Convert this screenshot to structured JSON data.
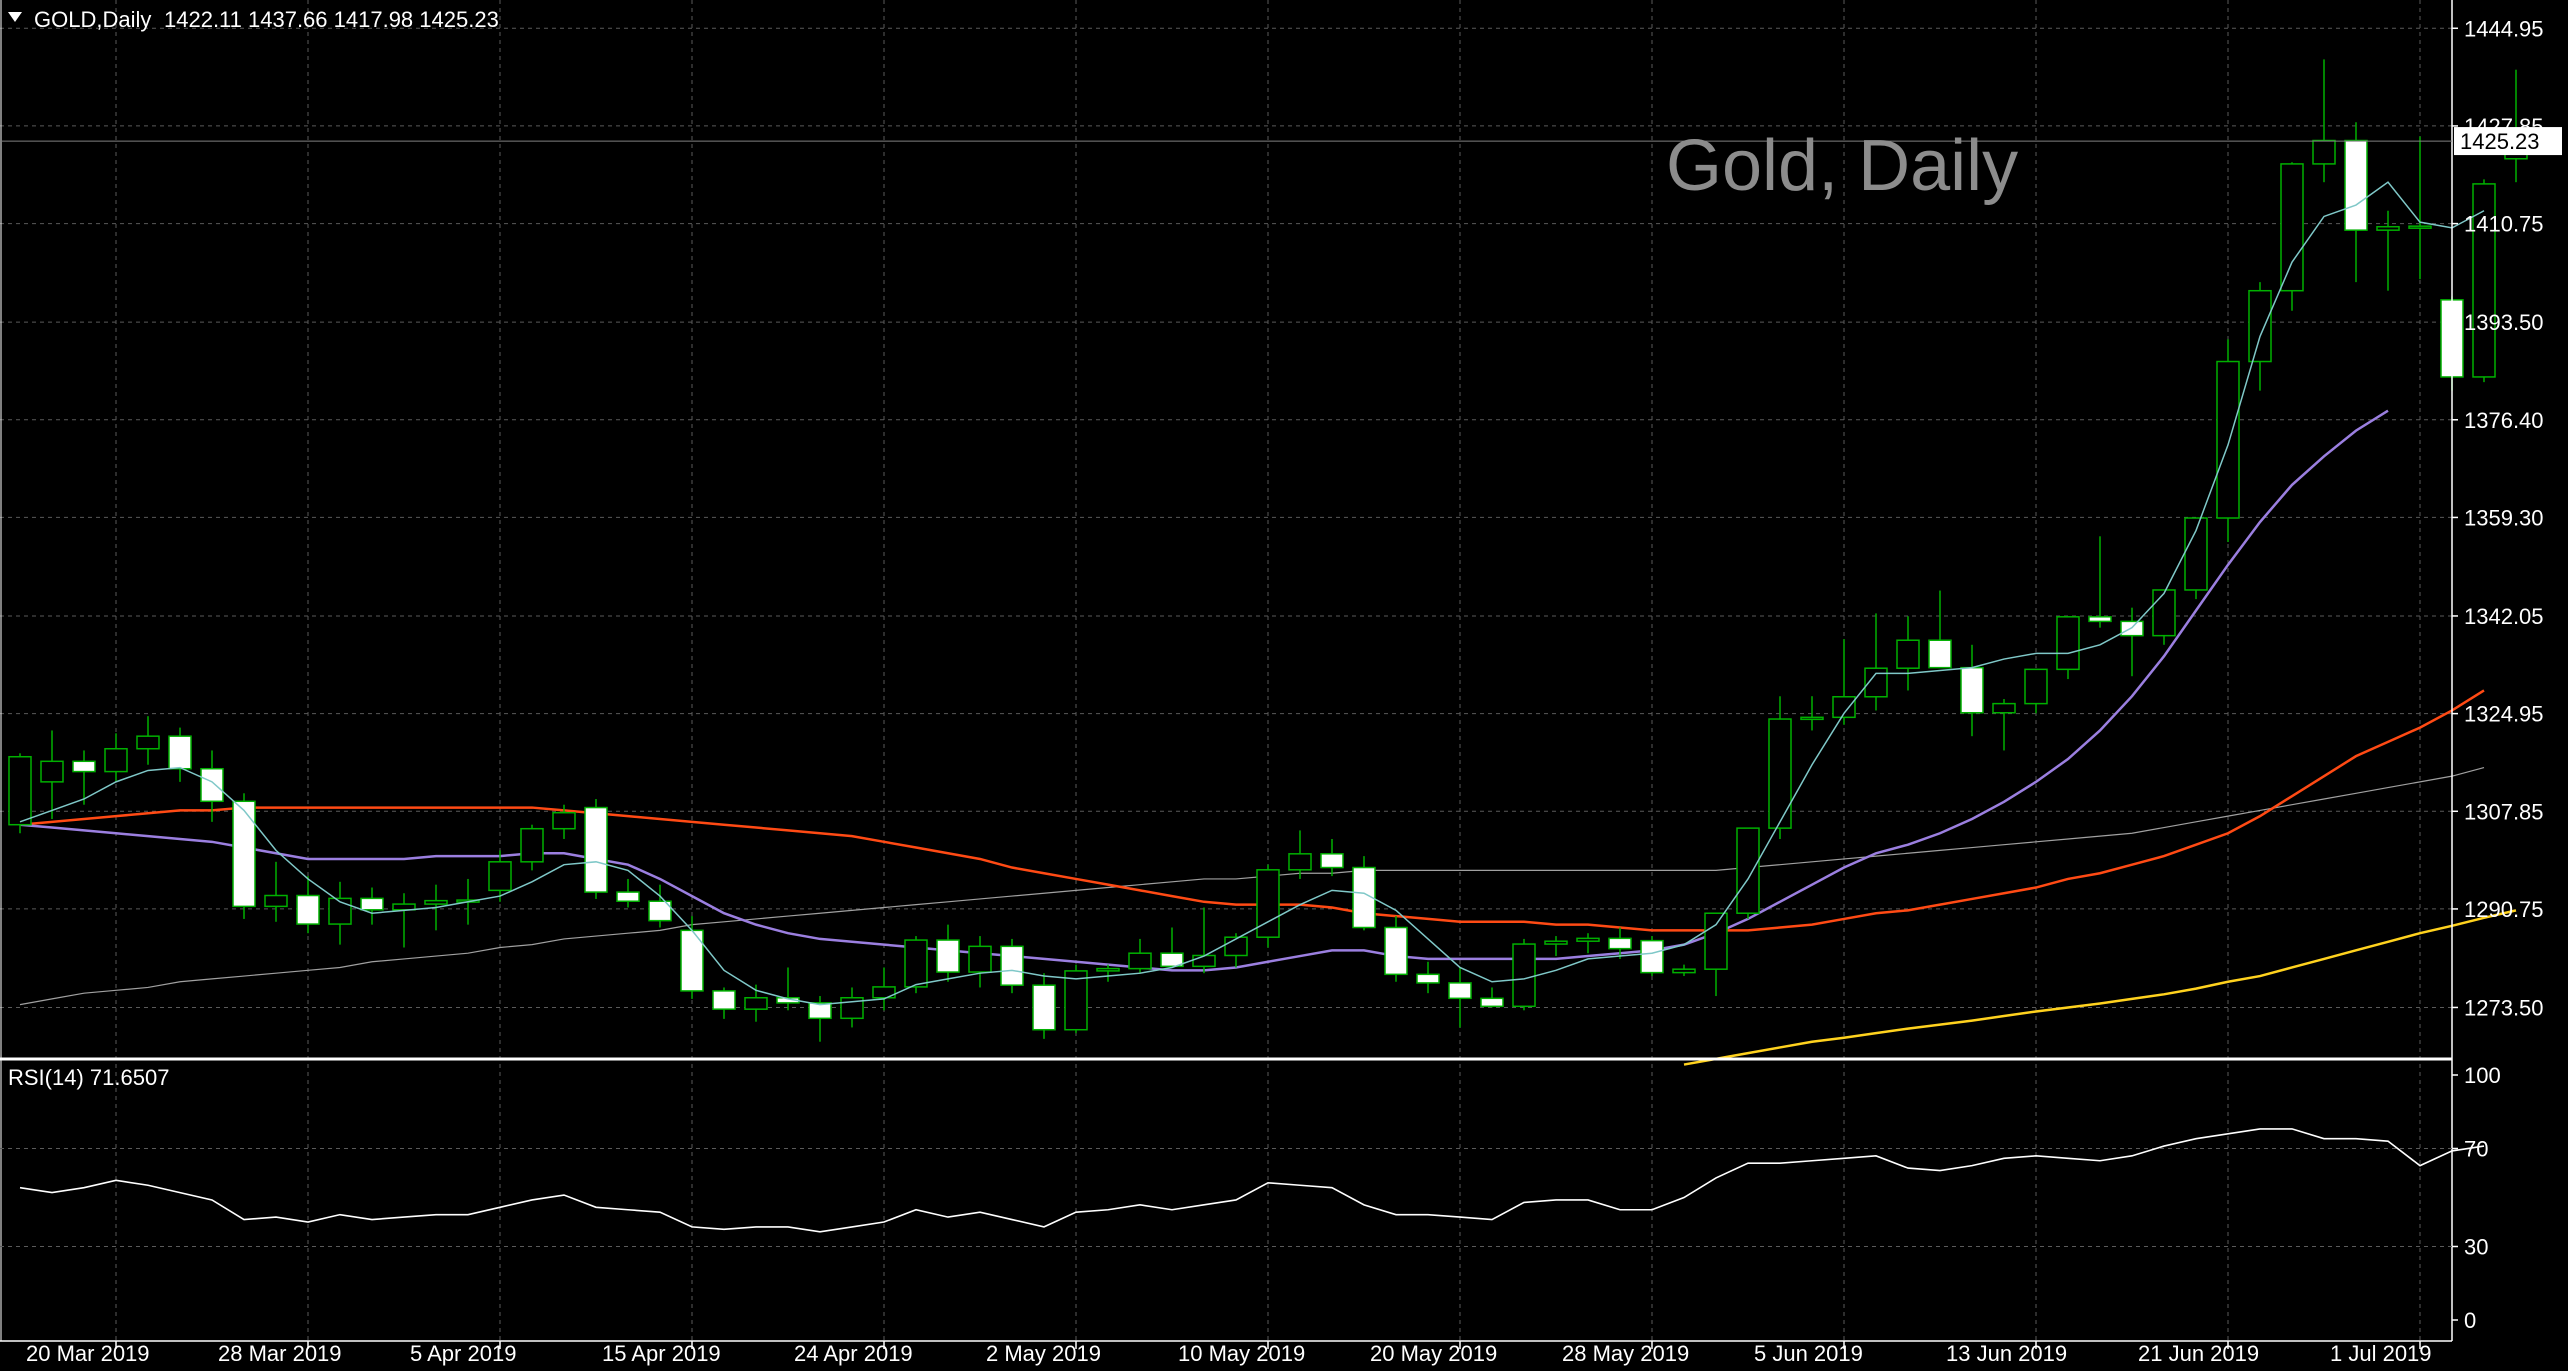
{
  "header": {
    "symbol": "GOLD,Daily",
    "ohlc": "1422.11 1437.66 1417.98 1425.23"
  },
  "watermark": "Gold, Daily",
  "price_label": "1425.23",
  "rsi_label": "RSI(14) 71.6507",
  "colors": {
    "background": "#000000",
    "bull_candle": "#00b000",
    "bear_fill": "#ffffff",
    "grid": "#5a5a5a",
    "ma_fast": "#7fc8c8",
    "ma_mid": "#9b7fe0",
    "ma_slow": "#ff4a14",
    "ma_long": "#a0a0a0",
    "ma_200": "#ffd21e",
    "rsi": "#ffffff"
  },
  "chart_data": {
    "type": "candlestick",
    "title": "GOLD,Daily",
    "x_tick_labels": [
      "20 Mar 2019",
      "28 Mar 2019",
      "5 Apr 2019",
      "15 Apr 2019",
      "24 Apr 2019",
      "2 May 2019",
      "10 May 2019",
      "20 May 2019",
      "28 May 2019",
      "5 Jun 2019",
      "13 Jun 2019",
      "21 Jun 2019",
      "1 Jul 2019"
    ],
    "x_tick_index": [
      3,
      9,
      15,
      21,
      27,
      33,
      39,
      45,
      51,
      57,
      63,
      69,
      75
    ],
    "y_ticks": [
      "1444.95",
      "1427.85",
      "1410.75",
      "1393.50",
      "1376.40",
      "1359.30",
      "1342.05",
      "1324.95",
      "1307.85",
      "1290.75",
      "1273.50"
    ],
    "ylim": [
      1265.0,
      1448.5
    ],
    "candles": [
      [
        1305.5,
        1318.0,
        1304.0,
        1317.4
      ],
      [
        1313.0,
        1322.0,
        1306.5,
        1316.6
      ],
      [
        1316.6,
        1318.5,
        1309.0,
        1314.8
      ],
      [
        1314.8,
        1321.5,
        1313.0,
        1318.8
      ],
      [
        1318.8,
        1324.5,
        1316.0,
        1321.0
      ],
      [
        1321.0,
        1322.5,
        1313.0,
        1315.3
      ],
      [
        1315.3,
        1318.5,
        1306.0,
        1309.6
      ],
      [
        1309.6,
        1311.0,
        1289.0,
        1291.2
      ],
      [
        1291.2,
        1299.0,
        1288.5,
        1293.1
      ],
      [
        1293.1,
        1296.5,
        1286.5,
        1288.1
      ],
      [
        1288.1,
        1295.5,
        1284.5,
        1292.6
      ],
      [
        1292.6,
        1294.5,
        1288.0,
        1290.6
      ],
      [
        1290.6,
        1293.5,
        1284.0,
        1291.6
      ],
      [
        1291.6,
        1295.0,
        1287.0,
        1292.2
      ],
      [
        1292.2,
        1296.0,
        1288.0,
        1292.3
      ],
      [
        1294.0,
        1301.0,
        1292.0,
        1299.0
      ],
      [
        1299.0,
        1305.5,
        1297.5,
        1304.8
      ],
      [
        1304.8,
        1309.0,
        1303.0,
        1307.6
      ],
      [
        1308.5,
        1310.0,
        1292.5,
        1293.7
      ],
      [
        1293.7,
        1296.0,
        1291.0,
        1292.1
      ],
      [
        1292.1,
        1295.0,
        1287.5,
        1288.7
      ],
      [
        1287.0,
        1289.5,
        1275.0,
        1276.4
      ],
      [
        1276.4,
        1277.0,
        1271.5,
        1273.2
      ],
      [
        1273.2,
        1277.5,
        1271.0,
        1275.2
      ],
      [
        1275.2,
        1280.5,
        1273.0,
        1274.3
      ],
      [
        1274.3,
        1275.5,
        1267.5,
        1271.6
      ],
      [
        1271.6,
        1277.0,
        1270.0,
        1275.2
      ],
      [
        1275.2,
        1280.5,
        1273.0,
        1277.1
      ],
      [
        1277.1,
        1286.0,
        1276.0,
        1285.3
      ],
      [
        1285.3,
        1288.0,
        1278.0,
        1279.7
      ],
      [
        1279.7,
        1286.0,
        1277.0,
        1284.2
      ],
      [
        1284.2,
        1285.5,
        1276.0,
        1277.4
      ],
      [
        1277.4,
        1279.5,
        1268.0,
        1269.6
      ],
      [
        1269.6,
        1281.0,
        1269.0,
        1279.9
      ],
      [
        1279.9,
        1281.0,
        1278.0,
        1280.3
      ],
      [
        1280.3,
        1285.5,
        1279.5,
        1283.0
      ],
      [
        1283.0,
        1287.5,
        1280.5,
        1280.7
      ],
      [
        1280.7,
        1291.0,
        1279.5,
        1282.6
      ],
      [
        1282.6,
        1286.5,
        1280.5,
        1285.8
      ],
      [
        1285.8,
        1298.5,
        1284.0,
        1297.6
      ],
      [
        1297.6,
        1304.5,
        1296.0,
        1300.4
      ],
      [
        1300.4,
        1303.0,
        1296.5,
        1298.0
      ],
      [
        1298.0,
        1300.0,
        1287.0,
        1287.5
      ],
      [
        1287.5,
        1289.5,
        1278.0,
        1279.3
      ],
      [
        1279.3,
        1281.5,
        1276.0,
        1277.8
      ],
      [
        1277.8,
        1280.5,
        1270.0,
        1275.1
      ],
      [
        1275.1,
        1277.0,
        1273.5,
        1273.7
      ],
      [
        1273.7,
        1285.5,
        1273.0,
        1284.6
      ],
      [
        1284.6,
        1286.0,
        1282.5,
        1285.1
      ],
      [
        1285.1,
        1286.5,
        1283.0,
        1285.6
      ],
      [
        1285.6,
        1287.5,
        1282.0,
        1283.8
      ],
      [
        1285.2,
        1286.0,
        1279.0,
        1279.6
      ],
      [
        1279.6,
        1281.0,
        1279.0,
        1280.2
      ],
      [
        1280.2,
        1290.0,
        1275.5,
        1290.0
      ],
      [
        1290.0,
        1305.0,
        1289.0,
        1304.9
      ],
      [
        1304.9,
        1328.0,
        1303.0,
        1324.0
      ],
      [
        1324.0,
        1328.0,
        1322.0,
        1324.3
      ],
      [
        1324.3,
        1338.0,
        1323.0,
        1327.9
      ],
      [
        1327.9,
        1342.5,
        1325.5,
        1332.9
      ],
      [
        1332.9,
        1342.0,
        1329.0,
        1337.8
      ],
      [
        1337.8,
        1346.5,
        1335.0,
        1333.0
      ],
      [
        1333.0,
        1337.0,
        1321.0,
        1325.1
      ],
      [
        1325.1,
        1327.5,
        1318.5,
        1326.7
      ],
      [
        1326.7,
        1331.5,
        1325.0,
        1332.7
      ],
      [
        1332.7,
        1342.0,
        1331.0,
        1341.9
      ],
      [
        1341.9,
        1356.0,
        1340.0,
        1341.1
      ],
      [
        1341.1,
        1343.5,
        1331.5,
        1338.6
      ],
      [
        1338.6,
        1346.0,
        1337.0,
        1346.6
      ],
      [
        1346.6,
        1358.0,
        1345.0,
        1359.2
      ],
      [
        1359.2,
        1390.5,
        1355.0,
        1386.6
      ],
      [
        1386.6,
        1400.5,
        1381.5,
        1399.0
      ],
      [
        1399.0,
        1421.5,
        1395.5,
        1421.2
      ],
      [
        1421.2,
        1439.5,
        1418.0,
        1425.3
      ],
      [
        1425.3,
        1428.5,
        1400.5,
        1409.6
      ],
      [
        1409.6,
        1413.0,
        1399.0,
        1410.2
      ],
      [
        1410.2,
        1426.0,
        1401.0,
        1410.3
      ],
      [
        1397.4,
        1398.0,
        1381.5,
        1383.9
      ],
      [
        1383.9,
        1418.5,
        1383.0,
        1417.7
      ],
      [
        1422.1,
        1437.7,
        1418.0,
        1425.2
      ]
    ],
    "ma_fast": [
      1306,
      1308,
      1310,
      1313,
      1315,
      1315.5,
      1313,
      1308,
      1301,
      1296,
      1292,
      1290,
      1290.5,
      1291,
      1292,
      1293,
      1295.5,
      1298.5,
      1299,
      1297.5,
      1293,
      1287,
      1280,
      1276.5,
      1275,
      1274,
      1274.5,
      1275,
      1277.5,
      1278.5,
      1279.5,
      1280,
      1279,
      1278.5,
      1279,
      1279.5,
      1280.5,
      1282.5,
      1285.5,
      1288.5,
      1291.5,
      1294,
      1293.5,
      1290.5,
      1285.5,
      1280.5,
      1278,
      1278.5,
      1280,
      1282,
      1282.5,
      1283,
      1284.5,
      1288,
      1296,
      1306,
      1316,
      1325,
      1332,
      1332,
      1332.5,
      1333,
      1334.5,
      1335.5,
      1335.5,
      1337,
      1340,
      1346,
      1357,
      1372,
      1391,
      1404,
      1412,
      1414,
      1418,
      1411,
      1410,
      1413
    ],
    "ma_mid": [
      1305.5,
      1305,
      1304.5,
      1304,
      1303.5,
      1303,
      1302.5,
      1301.5,
      1300.5,
      1299.5,
      1299.5,
      1299.5,
      1299.5,
      1300,
      1300,
      1300,
      1300.5,
      1300.5,
      1299.5,
      1298.5,
      1296,
      1293,
      1290,
      1288,
      1286.5,
      1285.5,
      1285,
      1284.5,
      1284,
      1283.5,
      1283,
      1282.5,
      1282,
      1281.5,
      1281,
      1280.5,
      1280,
      1280,
      1280.5,
      1281.5,
      1282.5,
      1283.5,
      1283.5,
      1282.5,
      1282,
      1282,
      1282,
      1282,
      1282,
      1282.5,
      1283,
      1283.5,
      1284.5,
      1286.5,
      1289,
      1292,
      1295,
      1298,
      1300.5,
      1302,
      1304,
      1306.5,
      1309.5,
      1313,
      1317,
      1322,
      1328,
      1335,
      1343,
      1351,
      1358.5,
      1365,
      1370,
      1374.5,
      1378
    ],
    "ma_slow": [
      1305.5,
      1306,
      1306.5,
      1307,
      1307.5,
      1308,
      1308,
      1308.5,
      1308.5,
      1308.5,
      1308.5,
      1308.5,
      1308.5,
      1308.5,
      1308.5,
      1308.5,
      1308.5,
      1308,
      1307.5,
      1307,
      1306.5,
      1306,
      1305.5,
      1305,
      1304.5,
      1304,
      1303.5,
      1302.5,
      1301.5,
      1300.5,
      1299.5,
      1298,
      1297,
      1296,
      1295,
      1294,
      1293,
      1292,
      1291.5,
      1291.5,
      1291.5,
      1291,
      1290,
      1289.5,
      1289,
      1288.5,
      1288.5,
      1288.5,
      1288,
      1288,
      1287.5,
      1287,
      1287,
      1287,
      1287,
      1287.5,
      1288,
      1289,
      1290,
      1290.5,
      1291.5,
      1292.5,
      1293.5,
      1294.5,
      1296,
      1297,
      1298.5,
      1300,
      1302,
      1304,
      1307,
      1310.5,
      1314,
      1317.5,
      1320,
      1322.5,
      1325.5,
      1329
    ],
    "ma_long": [
      1274,
      1275,
      1276,
      1276.5,
      1277,
      1278,
      1278.5,
      1279,
      1279.5,
      1280,
      1280.5,
      1281.5,
      1282,
      1282.5,
      1283,
      1284,
      1284.5,
      1285.5,
      1286,
      1286.5,
      1287,
      1288,
      1288.5,
      1289,
      1289.5,
      1290,
      1290.5,
      1291,
      1291.5,
      1292,
      1292.5,
      1293,
      1293.5,
      1294,
      1294.5,
      1295,
      1295.5,
      1296,
      1296,
      1296.5,
      1297,
      1297,
      1297.5,
      1297.5,
      1297.5,
      1297.5,
      1297.5,
      1297.5,
      1297.5,
      1297.5,
      1297.5,
      1297.5,
      1297.5,
      1297.5,
      1298,
      1298.5,
      1299,
      1299.5,
      1300,
      1300.5,
      1301,
      1301.5,
      1302,
      1302.5,
      1303,
      1303.5,
      1304,
      1305,
      1306,
      1307,
      1308,
      1309,
      1310,
      1311,
      1312,
      1313,
      1314,
      1315.5
    ],
    "ma_200_start_index": 52,
    "ma_200": [
      1263.5,
      1264.5,
      1265.5,
      1266.5,
      1267.5,
      1268.2,
      1269,
      1269.8,
      1270.5,
      1271.2,
      1272,
      1272.8,
      1273.5,
      1274.2,
      1275,
      1275.8,
      1276.8,
      1278,
      1279,
      1280.5,
      1282,
      1283.5,
      1285,
      1286.5,
      1287.8,
      1289.2,
      1290.5
    ],
    "rsi": {
      "name": "RSI(14)",
      "ticks": [
        "100",
        "70",
        "30",
        "0"
      ],
      "levels": [
        70,
        30
      ],
      "ylim": [
        0,
        100
      ],
      "values": [
        54,
        52,
        54,
        57,
        55,
        52,
        49,
        41,
        42,
        40,
        43,
        41,
        42,
        43,
        43,
        46,
        49,
        51,
        46,
        45,
        44,
        38,
        37,
        38,
        38,
        36,
        38,
        40,
        45,
        42,
        44,
        41,
        38,
        44,
        45,
        47,
        45,
        47,
        49,
        56,
        55,
        54,
        47,
        43,
        43,
        42,
        41,
        48,
        49,
        49,
        45,
        45,
        50,
        58,
        64,
        64,
        65,
        66,
        67,
        62,
        61,
        63,
        66,
        67,
        66,
        65,
        67,
        71,
        74,
        76,
        78,
        78,
        74,
        74,
        73,
        63,
        69,
        71
      ]
    }
  }
}
